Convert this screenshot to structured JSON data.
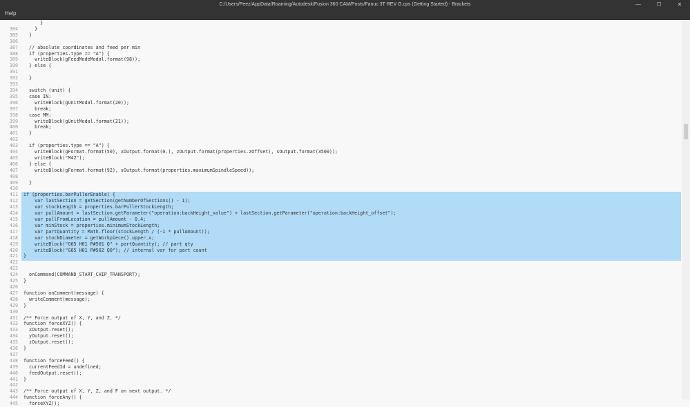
{
  "window": {
    "title": "C:/Users/Peez/AppData/Roaming/Autodesk/Fusion 360 CAM/Posts/Fanuc 3T REV G.cps (Getting Started) - Brackets"
  },
  "menu": {
    "help": "Help"
  },
  "editor": {
    "lines": [
      {
        "n": "",
        "t": "      }"
      },
      {
        "n": "384",
        "t": "    }"
      },
      {
        "n": "385",
        "t": "  }"
      },
      {
        "n": "386",
        "t": ""
      },
      {
        "n": "387",
        "t": "  // absolute coordinates and feed per min"
      },
      {
        "n": "388",
        "t": "  if (properties.type == \"A\") {"
      },
      {
        "n": "389",
        "t": "    writeBlock(gFeedModeModal.format(98));"
      },
      {
        "n": "390",
        "t": "  } else {"
      },
      {
        "n": "391",
        "t": ""
      },
      {
        "n": "392",
        "t": "  }"
      },
      {
        "n": "393",
        "t": ""
      },
      {
        "n": "394",
        "t": "  switch (unit) {"
      },
      {
        "n": "395",
        "t": "  case IN:"
      },
      {
        "n": "396",
        "t": "    writeBlock(gUnitModal.format(20));"
      },
      {
        "n": "397",
        "t": "    break;"
      },
      {
        "n": "398",
        "t": "  case MM:"
      },
      {
        "n": "399",
        "t": "    writeBlock(gUnitModal.format(21));"
      },
      {
        "n": "400",
        "t": "    break;"
      },
      {
        "n": "401",
        "t": "  }"
      },
      {
        "n": "402",
        "t": ""
      },
      {
        "n": "403",
        "t": "  if (properties.type == \"A\") {"
      },
      {
        "n": "404",
        "t": "    writeBlock(gFormat.format(50), xOutput.format(0.), zOutput.format(properties.zOffset), sOutput.format(3500));"
      },
      {
        "n": "405",
        "t": "    writeBlock(\"M42\");"
      },
      {
        "n": "406",
        "t": "  } else {"
      },
      {
        "n": "407",
        "t": "    writeBlock(gFormat.format(92), sOutput.format(properties.maximumSpindleSpeed));"
      },
      {
        "n": "408",
        "t": ""
      },
      {
        "n": "409",
        "t": "  }"
      },
      {
        "n": "410",
        "t": ""
      },
      {
        "n": "411",
        "t": "if (properties.barPullerEnable) {",
        "sel": true
      },
      {
        "n": "412",
        "t": "    var lastSection = getSection(getNumberOfSections() - 1);",
        "sel": true
      },
      {
        "n": "413",
        "t": "    var stockLength = properties.barPullerStockLength;",
        "sel": true
      },
      {
        "n": "414",
        "t": "    var pullAmount = lastSection.getParameter(\"operation:backHeight_value\") + lastSection.getParameter(\"operation:backHeight_offset\");",
        "sel": true
      },
      {
        "n": "415",
        "t": "    var pullFromLocation = pullAmount - 0.4;",
        "sel": true
      },
      {
        "n": "416",
        "t": "    var minStock = properties.minimumStockLength;",
        "sel": true
      },
      {
        "n": "417",
        "t": "    var partQuantity = Math.floor(stockLength / (-1 * pullAmount));",
        "sel": true
      },
      {
        "n": "418",
        "t": "    var stockDiameter = getWorkpiece().upper.x;",
        "sel": true
      },
      {
        "n": "419",
        "t": "    writeBlock(\"G65 H01 P#501 Q\" + partQuantity); // part qty",
        "sel": true
      },
      {
        "n": "420",
        "t": "    writeBlock(\"G65 H01 P#502 Q0\"); // internal var for part count",
        "sel": true
      },
      {
        "n": "421",
        "t": "}",
        "sel": true
      },
      {
        "n": "422",
        "t": ""
      },
      {
        "n": "423",
        "t": ""
      },
      {
        "n": "424",
        "t": "  onCommand(COMMAND_START_CHIP_TRANSPORT);"
      },
      {
        "n": "425",
        "t": "}"
      },
      {
        "n": "426",
        "t": ""
      },
      {
        "n": "427",
        "t": "function onComment(message) {"
      },
      {
        "n": "428",
        "t": "  writeComment(message);"
      },
      {
        "n": "429",
        "t": "}"
      },
      {
        "n": "430",
        "t": ""
      },
      {
        "n": "431",
        "t": "/** Force output of X, Y, and Z. */"
      },
      {
        "n": "432",
        "t": "function forceXYZ() {"
      },
      {
        "n": "433",
        "t": "  xOutput.reset();"
      },
      {
        "n": "434",
        "t": "  yOutput.reset();"
      },
      {
        "n": "435",
        "t": "  zOutput.reset();"
      },
      {
        "n": "436",
        "t": "}"
      },
      {
        "n": "437",
        "t": ""
      },
      {
        "n": "438",
        "t": "function forceFeed() {"
      },
      {
        "n": "439",
        "t": "  currentFeedId = undefined;"
      },
      {
        "n": "440",
        "t": "  feedOutput.reset();"
      },
      {
        "n": "441",
        "t": "}"
      },
      {
        "n": "442",
        "t": ""
      },
      {
        "n": "443",
        "t": "/** Force output of X, Y, Z, and F on next output. */"
      },
      {
        "n": "444",
        "t": "function forceAny() {"
      },
      {
        "n": "445",
        "t": "  forceXYZ();"
      }
    ]
  }
}
